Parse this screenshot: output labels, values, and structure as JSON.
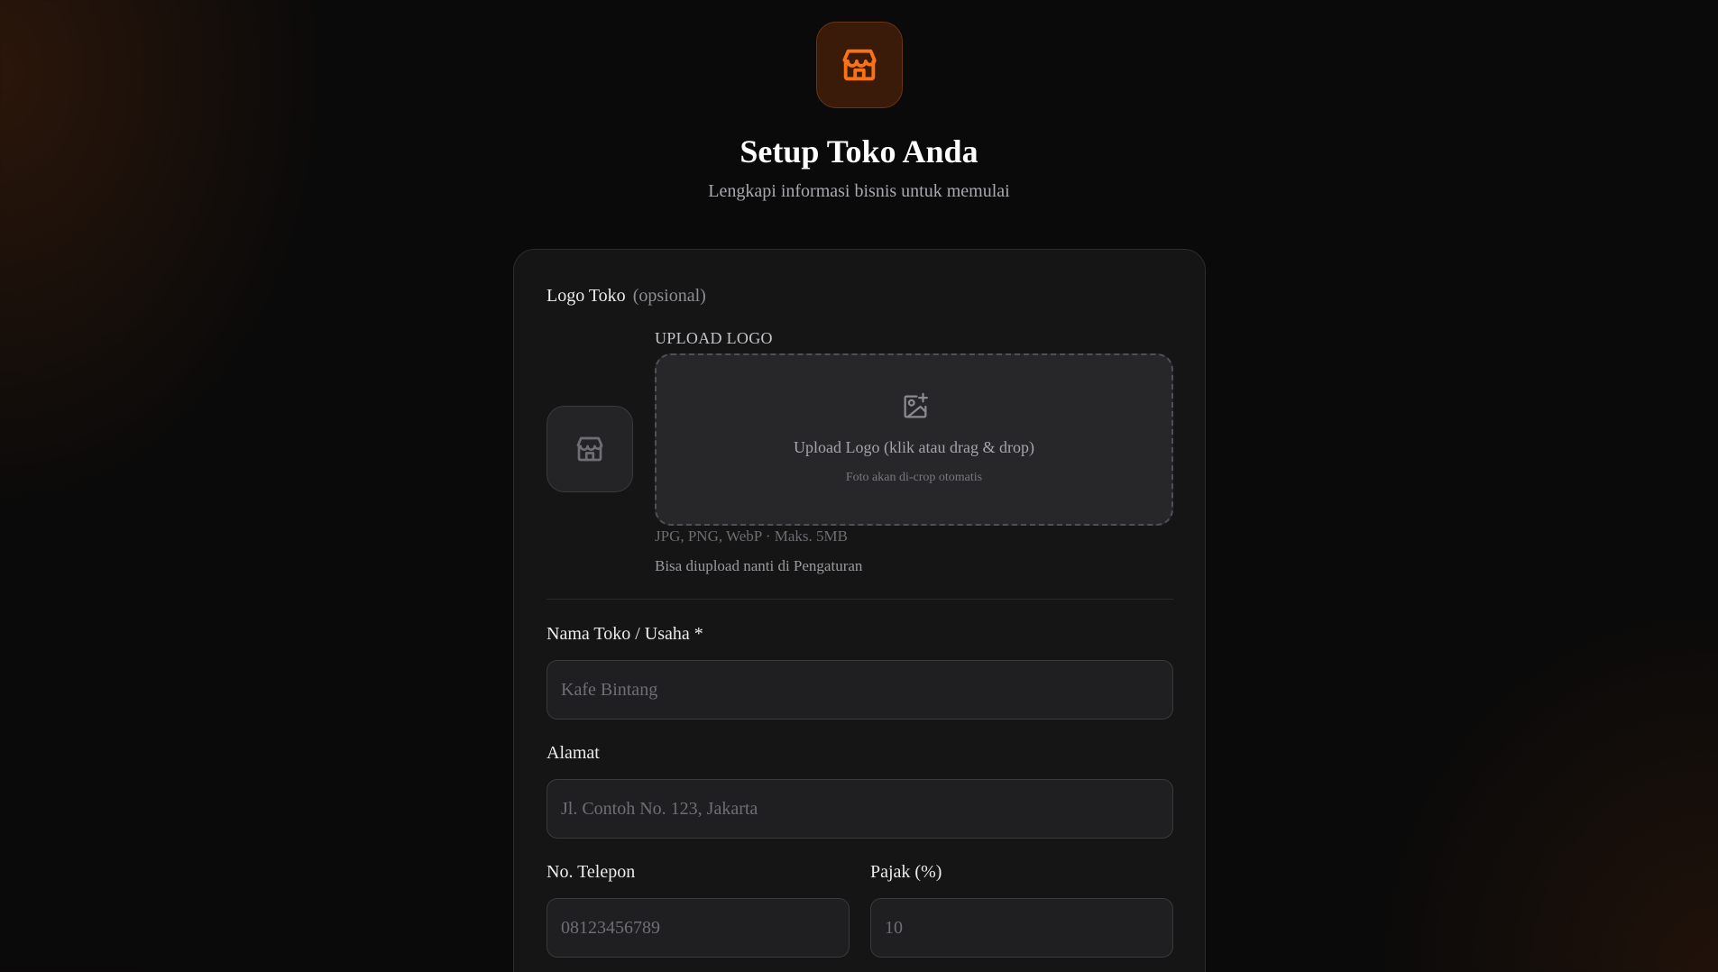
{
  "header": {
    "icon": "store-icon",
    "title": "Setup Toko Anda",
    "subtitle": "Lengkapi informasi bisnis untuk memulai"
  },
  "form": {
    "logo": {
      "label": "Logo Toko",
      "optional": "(opsional)",
      "upload_caption": "UPLOAD LOGO",
      "preview_icon": "store-icon",
      "dropzone_icon": "image-plus-icon",
      "dropzone_title": "Upload Logo (klik atau drag & drop)",
      "dropzone_sub": "Foto akan di-crop otomatis",
      "formats": "JPG, PNG, WebP · Maks. 5MB",
      "later_note": "Bisa diupload nanti di Pengaturan"
    },
    "store_name": {
      "label": "Nama Toko / Usaha *",
      "placeholder": "Kafe Bintang",
      "value": ""
    },
    "address": {
      "label": "Alamat",
      "placeholder": "Jl. Contoh No. 123, Jakarta",
      "value": ""
    },
    "phone": {
      "label": "No. Telepon",
      "placeholder": "08123456789",
      "value": ""
    },
    "tax": {
      "label": "Pajak (%)",
      "placeholder": "10",
      "value": ""
    }
  },
  "colors": {
    "accent": "#f97316",
    "background": "#0a0a0a",
    "card": "#151515"
  }
}
